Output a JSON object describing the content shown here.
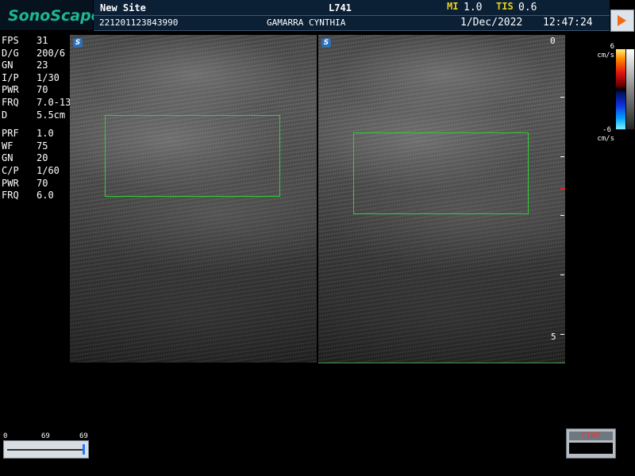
{
  "header": {
    "brand": "SonoScape",
    "site": "New Site",
    "probe": "L741",
    "mi_label": "MI",
    "mi_value": "1.0",
    "tis_label": "TIS",
    "tis_value": "0.6",
    "patient_id": "221201123843990",
    "patient_name": "GAMARRA CYNTHIA",
    "date": "1/Dec/2022",
    "time": "12:47:24"
  },
  "params_bmode": [
    {
      "key": "FPS",
      "value": "31"
    },
    {
      "key": "D/G",
      "value": "200/6"
    },
    {
      "key": "GN",
      "value": "23"
    },
    {
      "key": "I/P",
      "value": "1/30"
    },
    {
      "key": "PWR",
      "value": "70"
    },
    {
      "key": "FRQ",
      "value": "7.0-13"
    },
    {
      "key": "D",
      "value": "5.5cm"
    }
  ],
  "params_color": [
    {
      "key": "PRF",
      "value": "1.0"
    },
    {
      "key": "WF",
      "value": "75"
    },
    {
      "key": "GN",
      "value": "20"
    },
    {
      "key": "C/P",
      "value": "1/60"
    },
    {
      "key": "PWR",
      "value": "70"
    },
    {
      "key": "FRQ",
      "value": "6.0"
    }
  ],
  "depth_scale": {
    "top": "0",
    "bottom": "5"
  },
  "color_bar": {
    "max": "6",
    "min": "-6",
    "unit": "cm/s"
  },
  "cine": {
    "start": "0",
    "current": "69",
    "end": "69",
    "label": "CINE"
  },
  "colors": {
    "brand": "#1bb892",
    "roi": "#2fd033",
    "header_bg": "#0b1f35",
    "mi_tis": "#e8d21a"
  },
  "icons": [
    "play-icon",
    "sonoscape-s-icon"
  ]
}
